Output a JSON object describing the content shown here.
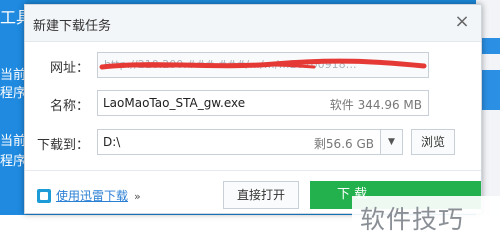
{
  "background": {
    "left_fragments": [
      "工具",
      "当前",
      "程序",
      "当前",
      "程序"
    ]
  },
  "dialog": {
    "title": "新建下载任务",
    "close_symbol": "×",
    "url": {
      "label": "网址：",
      "value": "http://210.200.###.###/…/…/…20200918…"
    },
    "filename": {
      "label": "名称：",
      "value": "LaoMaoTao_STA_gw.exe",
      "size_info": "软件 344.96 MB"
    },
    "download_to": {
      "label": "下载到：",
      "value": "D:\\",
      "free_space": "剩56.6 GB",
      "dropdown_symbol": "▼",
      "browse_label": "浏览"
    },
    "footer": {
      "xunlei_link": "使用迅雷下载",
      "expand_symbol": "»",
      "open_label": "直接打开",
      "download_label": "下 载"
    }
  },
  "watermark": "软件技巧",
  "colors": {
    "download_button": "#22b14c",
    "link": "#2a7fd4",
    "redaction": "#e53935"
  }
}
